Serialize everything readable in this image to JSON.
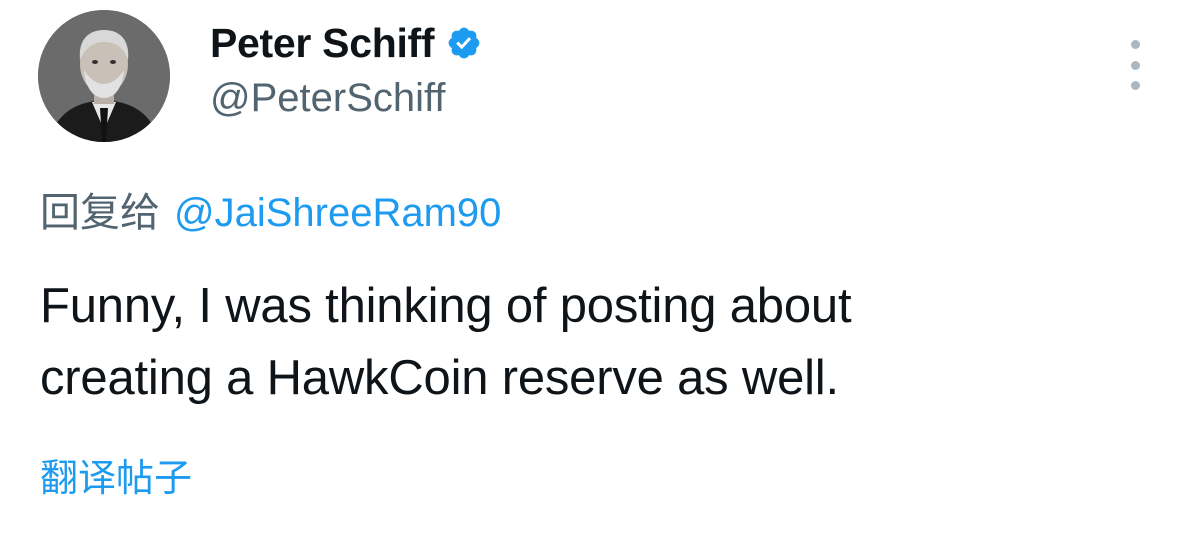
{
  "author": {
    "display_name": "Peter Schiff",
    "handle": "@PeterSchiff",
    "verified": true,
    "avatar_icon": "profile-photo",
    "badge_color": "#1d9bf0"
  },
  "menu": {
    "more_icon": "more-vertical-icon"
  },
  "reply": {
    "prefix": "回复给",
    "target": "@JaiShreeRam90"
  },
  "tweet": {
    "lines": [
      "Funny, I was thinking of posting about",
      "creating a HawkCoin reserve as well."
    ]
  },
  "translate": {
    "label": "翻译帖子"
  },
  "colors": {
    "text_primary": "#0f1419",
    "text_secondary": "#536471",
    "link": "#1d9bf0"
  }
}
